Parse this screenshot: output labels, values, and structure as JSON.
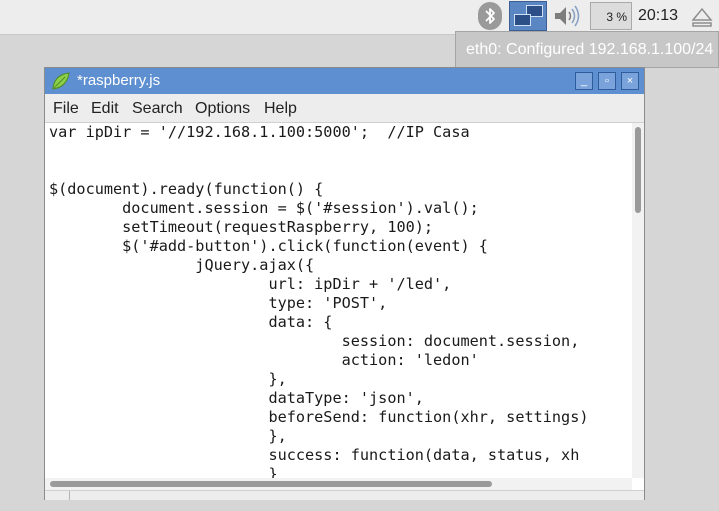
{
  "panel": {
    "bluetooth_icon": "bluetooth-icon",
    "network_icon": "network-icon",
    "volume_icon": "volume-icon",
    "cpu_usage": "3 %",
    "clock": "20:13",
    "eject_icon": "eject-icon"
  },
  "tooltip": {
    "text": "eth0: Configured 192.168.1.100/24"
  },
  "window": {
    "title": "*raspberry.js",
    "app_icon": "leafpad-icon",
    "minimize_label": "_",
    "maximize_label": "▫",
    "close_label": "×",
    "menu": [
      "File",
      "Edit",
      "Search",
      "Options",
      "Help"
    ],
    "code_lines": [
      "var ipDir = '//192.168.1.100:5000';  //IP Casa",
      "",
      "",
      "$(document).ready(function() {",
      "        document.session = $('#session').val();",
      "        setTimeout(requestRaspberry, 100);",
      "        $('#add-button').click(function(event) {",
      "                jQuery.ajax({",
      "                        url: ipDir + '/led',",
      "                        type: 'POST',",
      "                        data: {",
      "                                session: document.session,",
      "                                action: 'ledon'",
      "                        },",
      "                        dataType: 'json',",
      "                        beforeSend: function(xhr, settings)",
      "                        },",
      "                        success: function(data, status, xh",
      "                        }"
    ]
  },
  "colors": {
    "titlebar": "#5e8fd0",
    "tooltip": "#c7c7c7",
    "desktop": "#d6d6d6"
  }
}
